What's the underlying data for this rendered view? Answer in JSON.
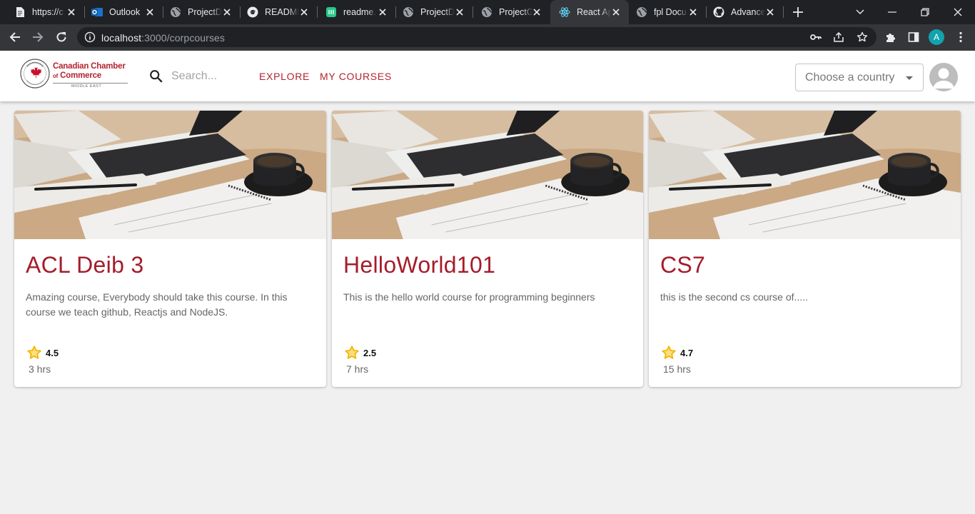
{
  "browser": {
    "tabs": [
      {
        "label": "https://c",
        "icon": "document-icon"
      },
      {
        "label": "Outlook",
        "icon": "outlook-icon"
      },
      {
        "label": "ProjectD",
        "icon": "globe-icon"
      },
      {
        "label": "README",
        "icon": "google-icon"
      },
      {
        "label": "readme.",
        "icon": "green-app-icon"
      },
      {
        "label": "ProjectD",
        "icon": "globe-icon"
      },
      {
        "label": "ProjectG",
        "icon": "globe-icon"
      },
      {
        "label": "React Ap",
        "icon": "react-icon",
        "active": true
      },
      {
        "label": "fpl Docu",
        "icon": "globe-icon"
      },
      {
        "label": "Advance",
        "icon": "github-icon"
      }
    ],
    "url_host": "localhost",
    "url_path": ":3000/corpcourses",
    "profile_initial": "A"
  },
  "header": {
    "logo": {
      "line1": "Canadian Chamber",
      "line2_prefix": "of",
      "line2_main": "Commerce",
      "line3": "MIDDLE EAST",
      "brand_color": "#b3232f"
    },
    "search_placeholder": "Search...",
    "nav": {
      "explore": "EXPLORE",
      "my_courses": "MY COURSES"
    },
    "country_select_value": "Choose a country"
  },
  "courses": [
    {
      "title": "ACL Deib 3",
      "description": "Amazing course, Everybody should take this course. In this course we teach github, Reactjs and NodeJS.",
      "rating": "4.5",
      "hours": "3 hrs"
    },
    {
      "title": "HelloWorld101",
      "description": "This is the hello world course for programming beginners",
      "rating": "2.5",
      "hours": "7 hrs"
    },
    {
      "title": "CS7",
      "description": "this is the second cs course of.....",
      "rating": "4.7",
      "hours": "15 hrs"
    }
  ],
  "colors": {
    "accent": "#b3232f",
    "course_title": "#a51c2b",
    "star": "#f5b400"
  }
}
